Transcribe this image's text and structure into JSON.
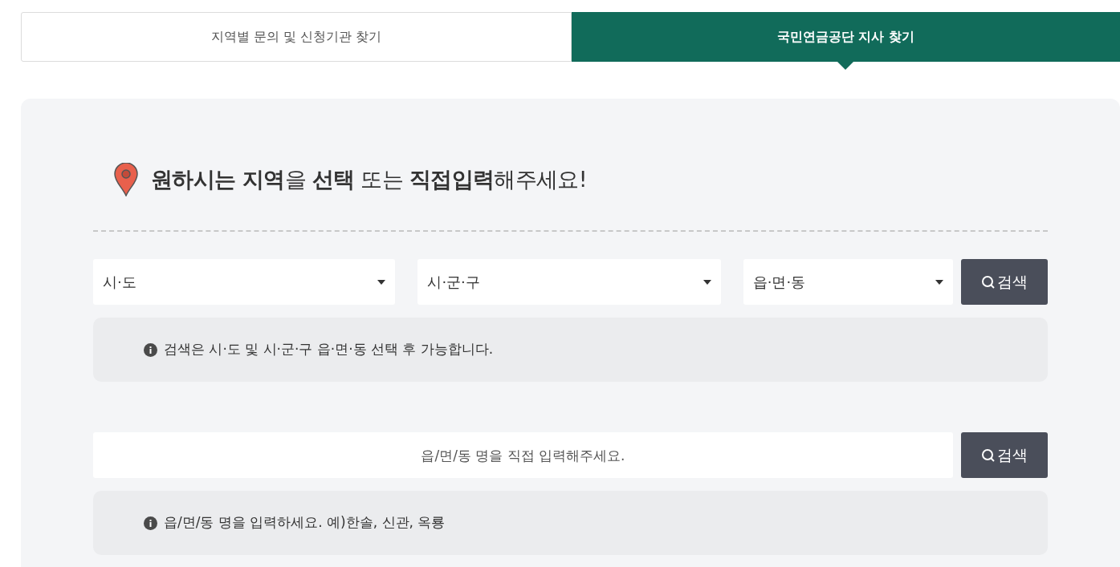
{
  "tabs": [
    {
      "label": "지역별 문의 및 신청기관 찾기",
      "selected": false
    },
    {
      "label": "국민연금공단 지사 찾기",
      "selected": true
    }
  ],
  "heading": "**원하시는 지역**을 **선택** 또는 **직접입력**해주세요!",
  "region_search": {
    "selects": [
      {
        "value": "시·도"
      },
      {
        "value": "시·군·구"
      },
      {
        "value": "읍·면·동"
      }
    ],
    "button": "검색",
    "notice": "검색은 시·도 및 시·군·구 읍·면·동 선택 후 가능합니다."
  },
  "direct_search": {
    "placeholder": "읍/면/동 명을 직접 입력해주세요.",
    "button": "검색",
    "notice": "읍/면/동 명을 입력하세요. 예)한솔, 신관, 옥룡"
  }
}
